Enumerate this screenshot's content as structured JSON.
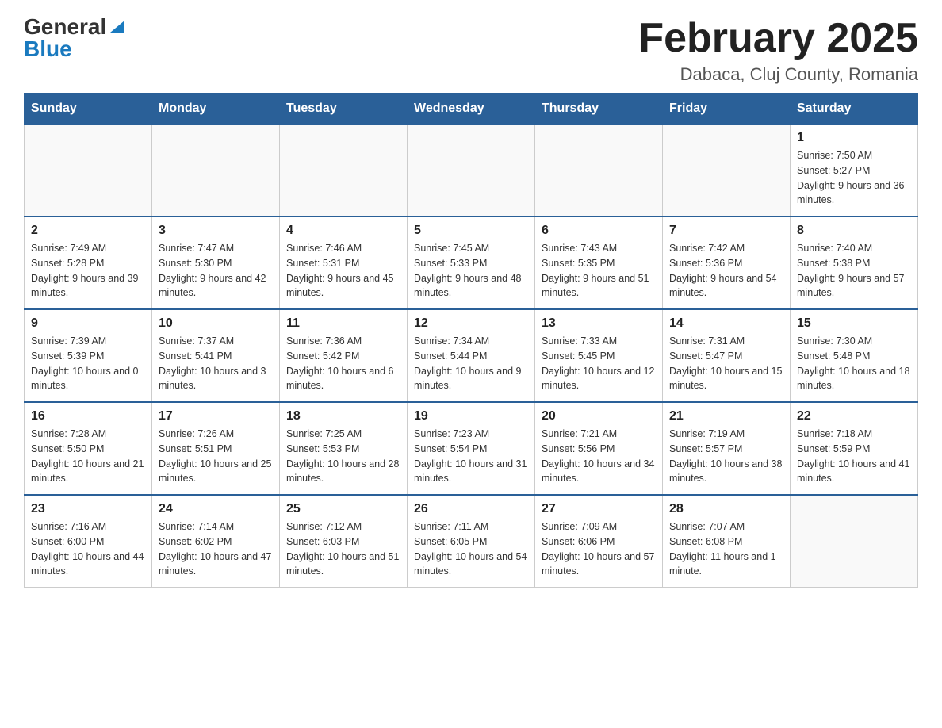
{
  "header": {
    "logo_general": "General",
    "logo_blue": "Blue",
    "month_title": "February 2025",
    "location": "Dabaca, Cluj County, Romania"
  },
  "days_of_week": [
    "Sunday",
    "Monday",
    "Tuesday",
    "Wednesday",
    "Thursday",
    "Friday",
    "Saturday"
  ],
  "weeks": [
    [
      {
        "day": "",
        "info": ""
      },
      {
        "day": "",
        "info": ""
      },
      {
        "day": "",
        "info": ""
      },
      {
        "day": "",
        "info": ""
      },
      {
        "day": "",
        "info": ""
      },
      {
        "day": "",
        "info": ""
      },
      {
        "day": "1",
        "info": "Sunrise: 7:50 AM\nSunset: 5:27 PM\nDaylight: 9 hours and 36 minutes."
      }
    ],
    [
      {
        "day": "2",
        "info": "Sunrise: 7:49 AM\nSunset: 5:28 PM\nDaylight: 9 hours and 39 minutes."
      },
      {
        "day": "3",
        "info": "Sunrise: 7:47 AM\nSunset: 5:30 PM\nDaylight: 9 hours and 42 minutes."
      },
      {
        "day": "4",
        "info": "Sunrise: 7:46 AM\nSunset: 5:31 PM\nDaylight: 9 hours and 45 minutes."
      },
      {
        "day": "5",
        "info": "Sunrise: 7:45 AM\nSunset: 5:33 PM\nDaylight: 9 hours and 48 minutes."
      },
      {
        "day": "6",
        "info": "Sunrise: 7:43 AM\nSunset: 5:35 PM\nDaylight: 9 hours and 51 minutes."
      },
      {
        "day": "7",
        "info": "Sunrise: 7:42 AM\nSunset: 5:36 PM\nDaylight: 9 hours and 54 minutes."
      },
      {
        "day": "8",
        "info": "Sunrise: 7:40 AM\nSunset: 5:38 PM\nDaylight: 9 hours and 57 minutes."
      }
    ],
    [
      {
        "day": "9",
        "info": "Sunrise: 7:39 AM\nSunset: 5:39 PM\nDaylight: 10 hours and 0 minutes."
      },
      {
        "day": "10",
        "info": "Sunrise: 7:37 AM\nSunset: 5:41 PM\nDaylight: 10 hours and 3 minutes."
      },
      {
        "day": "11",
        "info": "Sunrise: 7:36 AM\nSunset: 5:42 PM\nDaylight: 10 hours and 6 minutes."
      },
      {
        "day": "12",
        "info": "Sunrise: 7:34 AM\nSunset: 5:44 PM\nDaylight: 10 hours and 9 minutes."
      },
      {
        "day": "13",
        "info": "Sunrise: 7:33 AM\nSunset: 5:45 PM\nDaylight: 10 hours and 12 minutes."
      },
      {
        "day": "14",
        "info": "Sunrise: 7:31 AM\nSunset: 5:47 PM\nDaylight: 10 hours and 15 minutes."
      },
      {
        "day": "15",
        "info": "Sunrise: 7:30 AM\nSunset: 5:48 PM\nDaylight: 10 hours and 18 minutes."
      }
    ],
    [
      {
        "day": "16",
        "info": "Sunrise: 7:28 AM\nSunset: 5:50 PM\nDaylight: 10 hours and 21 minutes."
      },
      {
        "day": "17",
        "info": "Sunrise: 7:26 AM\nSunset: 5:51 PM\nDaylight: 10 hours and 25 minutes."
      },
      {
        "day": "18",
        "info": "Sunrise: 7:25 AM\nSunset: 5:53 PM\nDaylight: 10 hours and 28 minutes."
      },
      {
        "day": "19",
        "info": "Sunrise: 7:23 AM\nSunset: 5:54 PM\nDaylight: 10 hours and 31 minutes."
      },
      {
        "day": "20",
        "info": "Sunrise: 7:21 AM\nSunset: 5:56 PM\nDaylight: 10 hours and 34 minutes."
      },
      {
        "day": "21",
        "info": "Sunrise: 7:19 AM\nSunset: 5:57 PM\nDaylight: 10 hours and 38 minutes."
      },
      {
        "day": "22",
        "info": "Sunrise: 7:18 AM\nSunset: 5:59 PM\nDaylight: 10 hours and 41 minutes."
      }
    ],
    [
      {
        "day": "23",
        "info": "Sunrise: 7:16 AM\nSunset: 6:00 PM\nDaylight: 10 hours and 44 minutes."
      },
      {
        "day": "24",
        "info": "Sunrise: 7:14 AM\nSunset: 6:02 PM\nDaylight: 10 hours and 47 minutes."
      },
      {
        "day": "25",
        "info": "Sunrise: 7:12 AM\nSunset: 6:03 PM\nDaylight: 10 hours and 51 minutes."
      },
      {
        "day": "26",
        "info": "Sunrise: 7:11 AM\nSunset: 6:05 PM\nDaylight: 10 hours and 54 minutes."
      },
      {
        "day": "27",
        "info": "Sunrise: 7:09 AM\nSunset: 6:06 PM\nDaylight: 10 hours and 57 minutes."
      },
      {
        "day": "28",
        "info": "Sunrise: 7:07 AM\nSunset: 6:08 PM\nDaylight: 11 hours and 1 minute."
      },
      {
        "day": "",
        "info": ""
      }
    ]
  ]
}
